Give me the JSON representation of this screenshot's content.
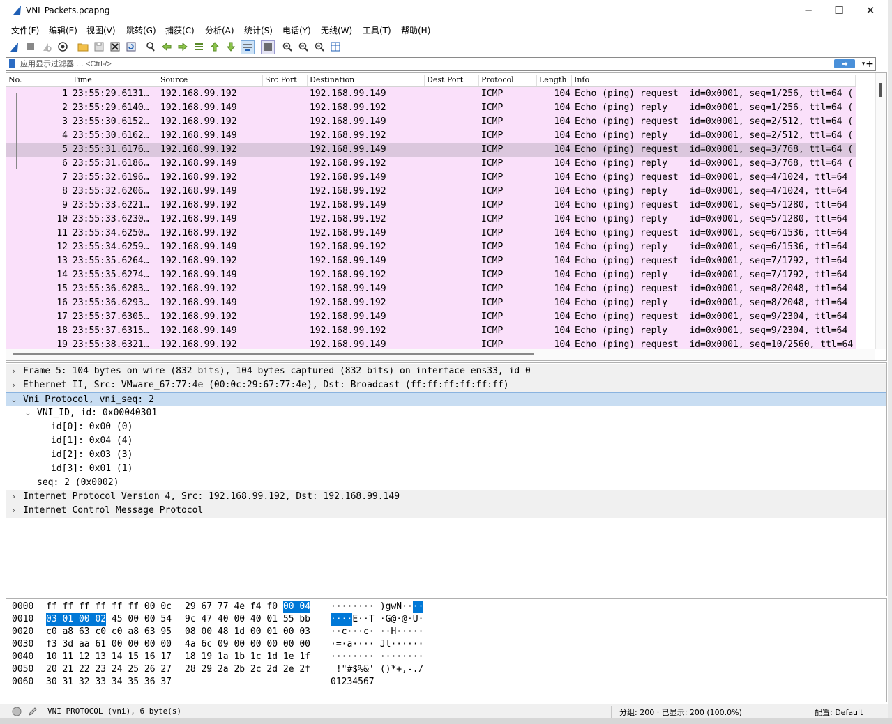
{
  "window": {
    "title": "VNI_Packets.pcapng"
  },
  "menu": [
    "文件(F)",
    "编辑(E)",
    "视图(V)",
    "跳转(G)",
    "捕获(C)",
    "分析(A)",
    "统计(S)",
    "电话(Y)",
    "无线(W)",
    "工具(T)",
    "帮助(H)"
  ],
  "toolbar_icons": [
    "shark-start-icon",
    "stop-icon",
    "restart-icon",
    "options-icon",
    "open-folder-icon",
    "save-icon",
    "close-file-icon",
    "reload-icon",
    "find-icon",
    "back-arrow-icon",
    "forward-arrow-icon",
    "goto-packet-icon",
    "first-packet-icon",
    "last-packet-icon",
    "autoscroll-icon",
    "colorize-icon",
    "zoom-in-icon",
    "zoom-out-icon",
    "zoom-reset-icon",
    "resize-columns-icon"
  ],
  "filter": {
    "placeholder": "应用显示过滤器 … <Ctrl-/>",
    "apply_label": "➡",
    "dropdown_label": "▾",
    "plus_label": "+"
  },
  "columns": [
    "No.",
    "Time",
    "Source",
    "Src Port",
    "Destination",
    "Dest Port",
    "Protocol",
    "Length",
    "Info"
  ],
  "packets": [
    {
      "no": "1",
      "time": "23:55:29.6131…",
      "src": "192.168.99.192",
      "dst": "192.168.99.149",
      "proto": "ICMP",
      "len": "104",
      "info": "Echo (ping) request  id=0x0001, seq=1/256, ttl=64 ("
    },
    {
      "no": "2",
      "time": "23:55:29.6140…",
      "src": "192.168.99.149",
      "dst": "192.168.99.192",
      "proto": "ICMP",
      "len": "104",
      "info": "Echo (ping) reply    id=0x0001, seq=1/256, ttl=64 ("
    },
    {
      "no": "3",
      "time": "23:55:30.6152…",
      "src": "192.168.99.192",
      "dst": "192.168.99.149",
      "proto": "ICMP",
      "len": "104",
      "info": "Echo (ping) request  id=0x0001, seq=2/512, ttl=64 ("
    },
    {
      "no": "4",
      "time": "23:55:30.6162…",
      "src": "192.168.99.149",
      "dst": "192.168.99.192",
      "proto": "ICMP",
      "len": "104",
      "info": "Echo (ping) reply    id=0x0001, seq=2/512, ttl=64 ("
    },
    {
      "no": "5",
      "time": "23:55:31.6176…",
      "src": "192.168.99.192",
      "dst": "192.168.99.149",
      "proto": "ICMP",
      "len": "104",
      "info": "Echo (ping) request  id=0x0001, seq=3/768, ttl=64 ("
    },
    {
      "no": "6",
      "time": "23:55:31.6186…",
      "src": "192.168.99.149",
      "dst": "192.168.99.192",
      "proto": "ICMP",
      "len": "104",
      "info": "Echo (ping) reply    id=0x0001, seq=3/768, ttl=64 ("
    },
    {
      "no": "7",
      "time": "23:55:32.6196…",
      "src": "192.168.99.192",
      "dst": "192.168.99.149",
      "proto": "ICMP",
      "len": "104",
      "info": "Echo (ping) request  id=0x0001, seq=4/1024, ttl=64"
    },
    {
      "no": "8",
      "time": "23:55:32.6206…",
      "src": "192.168.99.149",
      "dst": "192.168.99.192",
      "proto": "ICMP",
      "len": "104",
      "info": "Echo (ping) reply    id=0x0001, seq=4/1024, ttl=64"
    },
    {
      "no": "9",
      "time": "23:55:33.6221…",
      "src": "192.168.99.192",
      "dst": "192.168.99.149",
      "proto": "ICMP",
      "len": "104",
      "info": "Echo (ping) request  id=0x0001, seq=5/1280, ttl=64"
    },
    {
      "no": "10",
      "time": "23:55:33.6230…",
      "src": "192.168.99.149",
      "dst": "192.168.99.192",
      "proto": "ICMP",
      "len": "104",
      "info": "Echo (ping) reply    id=0x0001, seq=5/1280, ttl=64"
    },
    {
      "no": "11",
      "time": "23:55:34.6250…",
      "src": "192.168.99.192",
      "dst": "192.168.99.149",
      "proto": "ICMP",
      "len": "104",
      "info": "Echo (ping) request  id=0x0001, seq=6/1536, ttl=64"
    },
    {
      "no": "12",
      "time": "23:55:34.6259…",
      "src": "192.168.99.149",
      "dst": "192.168.99.192",
      "proto": "ICMP",
      "len": "104",
      "info": "Echo (ping) reply    id=0x0001, seq=6/1536, ttl=64"
    },
    {
      "no": "13",
      "time": "23:55:35.6264…",
      "src": "192.168.99.192",
      "dst": "192.168.99.149",
      "proto": "ICMP",
      "len": "104",
      "info": "Echo (ping) request  id=0x0001, seq=7/1792, ttl=64"
    },
    {
      "no": "14",
      "time": "23:55:35.6274…",
      "src": "192.168.99.149",
      "dst": "192.168.99.192",
      "proto": "ICMP",
      "len": "104",
      "info": "Echo (ping) reply    id=0x0001, seq=7/1792, ttl=64"
    },
    {
      "no": "15",
      "time": "23:55:36.6283…",
      "src": "192.168.99.192",
      "dst": "192.168.99.149",
      "proto": "ICMP",
      "len": "104",
      "info": "Echo (ping) request  id=0x0001, seq=8/2048, ttl=64"
    },
    {
      "no": "16",
      "time": "23:55:36.6293…",
      "src": "192.168.99.149",
      "dst": "192.168.99.192",
      "proto": "ICMP",
      "len": "104",
      "info": "Echo (ping) reply    id=0x0001, seq=8/2048, ttl=64"
    },
    {
      "no": "17",
      "time": "23:55:37.6305…",
      "src": "192.168.99.192",
      "dst": "192.168.99.149",
      "proto": "ICMP",
      "len": "104",
      "info": "Echo (ping) request  id=0x0001, seq=9/2304, ttl=64"
    },
    {
      "no": "18",
      "time": "23:55:37.6315…",
      "src": "192.168.99.149",
      "dst": "192.168.99.192",
      "proto": "ICMP",
      "len": "104",
      "info": "Echo (ping) reply    id=0x0001, seq=9/2304, ttl=64"
    },
    {
      "no": "19",
      "time": "23:55:38.6321…",
      "src": "192.168.99.192",
      "dst": "192.168.99.149",
      "proto": "ICMP",
      "len": "104",
      "info": "Echo (ping) request  id=0x0001, seq=10/2560, ttl=64"
    }
  ],
  "selected_packet": "5",
  "details": [
    {
      "text": "Frame 5: 104 bytes on wire (832 bits), 104 bytes captured (832 bits) on interface ens33, id 0",
      "level": 0,
      "arrow": "›",
      "style": "shaded"
    },
    {
      "text": "Ethernet II, Src: VMware_67:77:4e (00:0c:29:67:77:4e), Dst: Broadcast (ff:ff:ff:ff:ff:ff)",
      "level": 0,
      "arrow": "›",
      "style": "shaded"
    },
    {
      "text": "Vni Protocol, vni_seq: 2",
      "level": 0,
      "arrow": "⌄",
      "style": "selected"
    },
    {
      "text": "VNI_ID, id: 0x00040301",
      "level": 1,
      "arrow": "⌄",
      "style": "none"
    },
    {
      "text": "id[0]: 0x00 (0)",
      "level": 2,
      "arrow": "",
      "style": "none"
    },
    {
      "text": "id[1]: 0x04 (4)",
      "level": 2,
      "arrow": "",
      "style": "none"
    },
    {
      "text": "id[2]: 0x03 (3)",
      "level": 2,
      "arrow": "",
      "style": "none"
    },
    {
      "text": "id[3]: 0x01 (1)",
      "level": 2,
      "arrow": "",
      "style": "none"
    },
    {
      "text": "seq: 2 (0x0002)",
      "level": 1,
      "arrow": "",
      "style": "none"
    },
    {
      "text": "Internet Protocol Version 4, Src: 192.168.99.192, Dst: 192.168.99.149",
      "level": 0,
      "arrow": "›",
      "style": "shaded"
    },
    {
      "text": "Internet Control Message Protocol",
      "level": 0,
      "arrow": "›",
      "style": "shaded"
    }
  ],
  "bytes": [
    {
      "offset": "0000",
      "hex1": "ff ff ff ff ff ff 00 0c",
      "hex2": "29 67 77 4e f4 f0",
      "hex2_hl": "00 04",
      "ascii1": "········",
      "ascii2": " )gwN··",
      "ascii2_hl": "··"
    },
    {
      "offset": "0010",
      "hex1_hl": "03 01 00 02",
      "hex1": " 45 00 00 54",
      "hex2": "9c 47 40 00 40 01 55 bb",
      "ascii1_hl": "····",
      "ascii1": "E··T",
      "ascii2": " ·G@·@·U·"
    },
    {
      "offset": "0020",
      "hex1": "c0 a8 63 c0 c0 a8 63 95",
      "hex2": "08 00 48 1d 00 01 00 03",
      "ascii1": "··c···c·",
      "ascii2": " ··H·····"
    },
    {
      "offset": "0030",
      "hex1": "f3 3d aa 61 00 00 00 00",
      "hex2": "4a 6c 09 00 00 00 00 00",
      "ascii1": "·=·a····",
      "ascii2": " Jl······"
    },
    {
      "offset": "0040",
      "hex1": "10 11 12 13 14 15 16 17",
      "hex2": "18 19 1a 1b 1c 1d 1e 1f",
      "ascii1": "········",
      "ascii2": " ········"
    },
    {
      "offset": "0050",
      "hex1": "20 21 22 23 24 25 26 27",
      "hex2": "28 29 2a 2b 2c 2d 2e 2f",
      "ascii1": " !\"#$%&'",
      "ascii2": " ()*+,-./"
    },
    {
      "offset": "0060",
      "hex1": "30 31 32 33 34 35 36 37",
      "hex2": "",
      "ascii1": "01234567",
      "ascii2": ""
    }
  ],
  "status": {
    "field": "VNI PROTOCOL (vni), 6 byte(s)",
    "packets": "分组: 200 · 已显示: 200 (100.0%)",
    "profile": "配置: Default"
  },
  "colors": {
    "row_bg": "#fae0fa",
    "row_selected": "#dbc7dd",
    "detail_selected": "#c8ddf2",
    "byte_highlight": "#0078d7"
  }
}
